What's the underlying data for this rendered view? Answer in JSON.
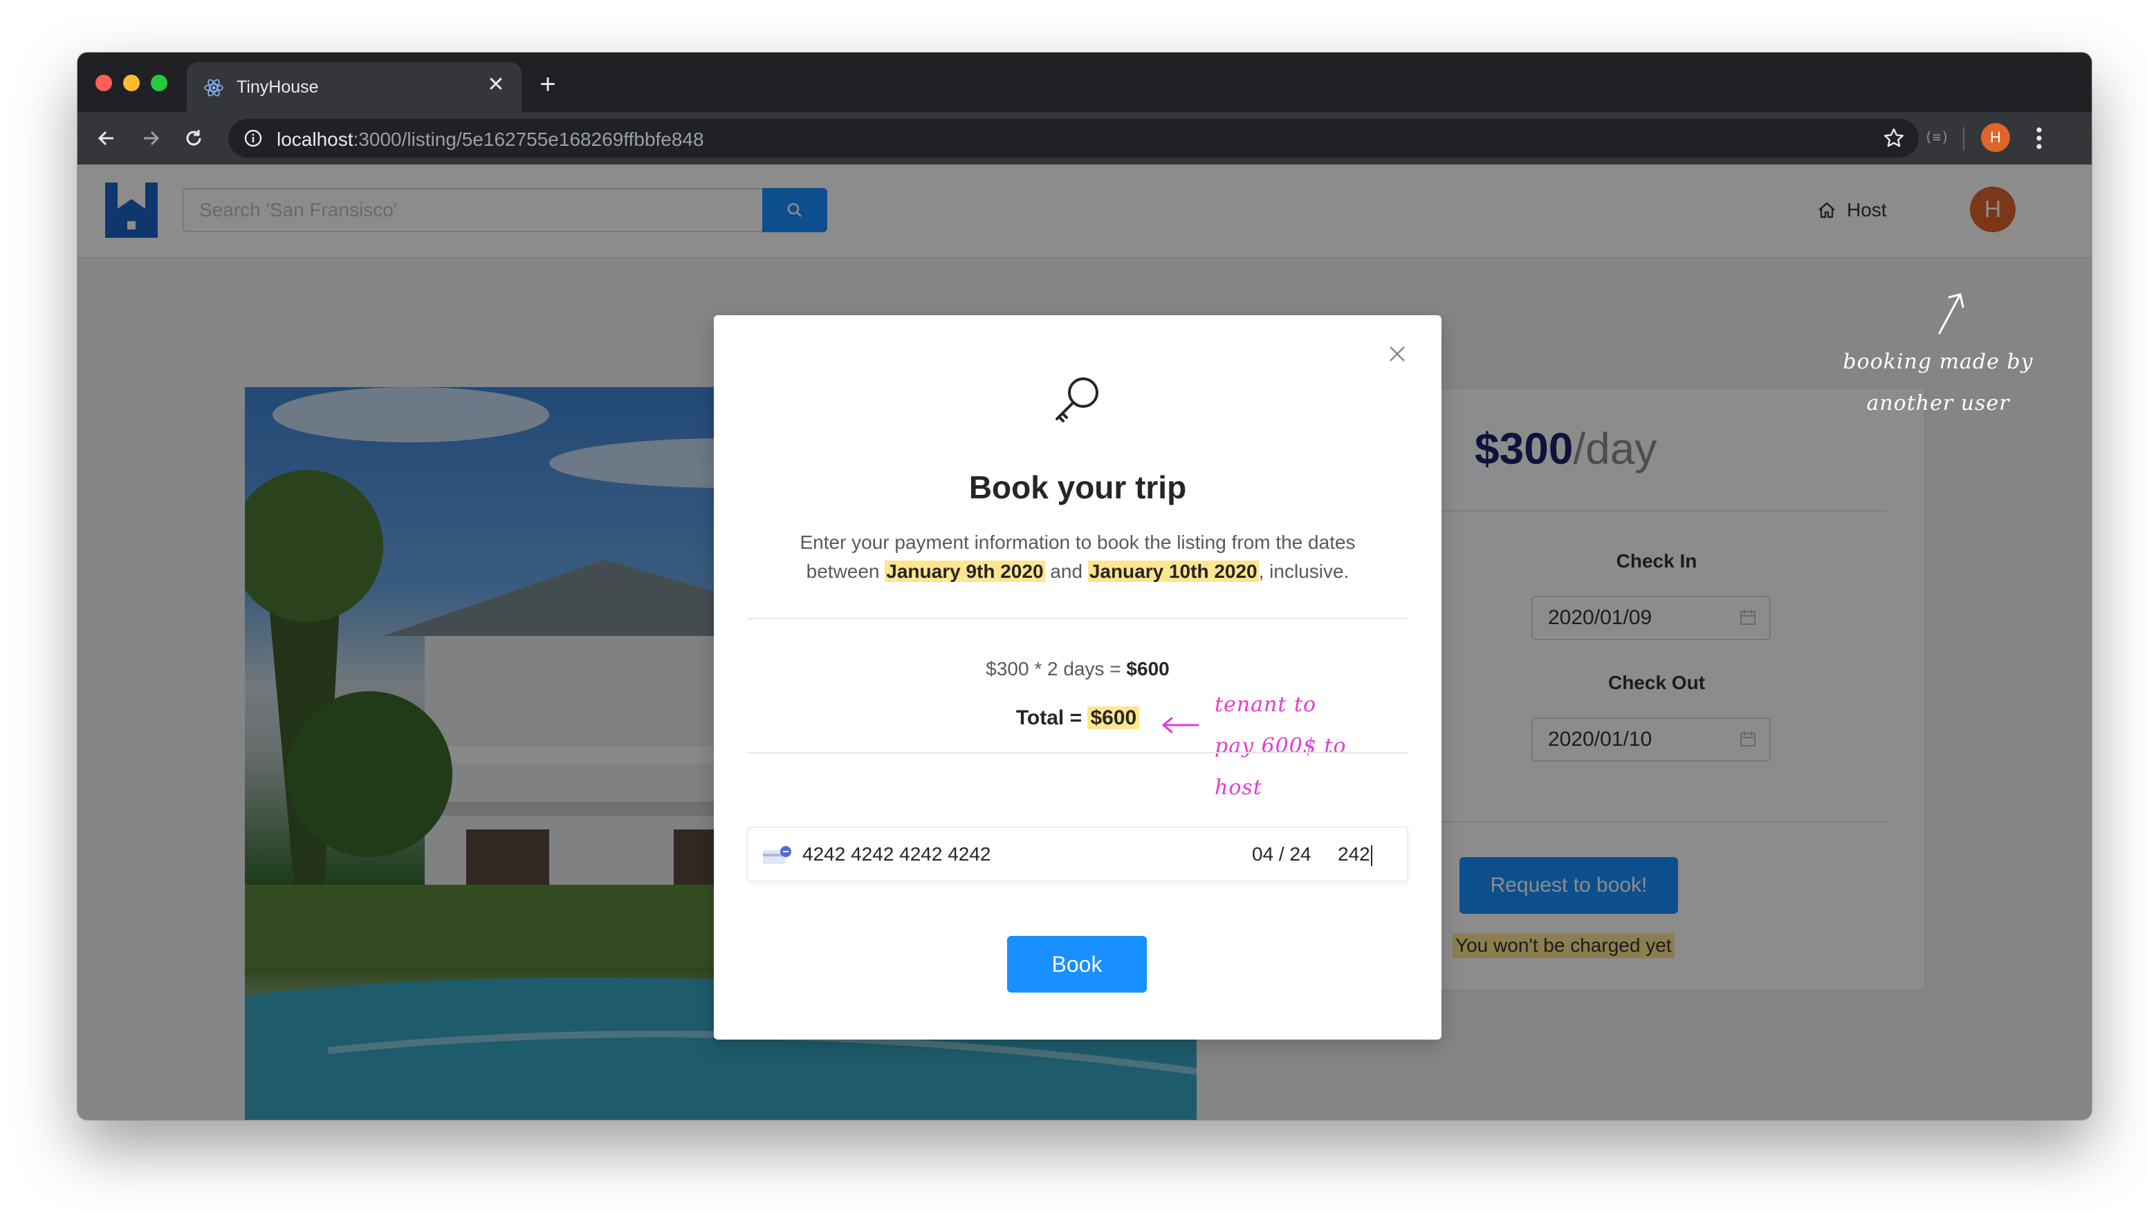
{
  "browser": {
    "tab_title": "TinyHouse",
    "new_tab": "+",
    "tab_close": "✕",
    "url_host": "localhost",
    "url_path": ":3000/listing/5e162755e168269ffbbfe848",
    "extension_label": "(≡)",
    "profile_initial": "H"
  },
  "header": {
    "search_placeholder": "Search 'San Fransisco'",
    "host_label": "Host",
    "avatar_initial": "H"
  },
  "listing": {
    "price": "$300",
    "price_unit": "/day",
    "check_in_label": "Check In",
    "check_in_value": "2020/01/09",
    "check_out_label": "Check Out",
    "check_out_value": "2020/01/10",
    "request_button": "Request to book!",
    "charge_note": "You won't be charged yet"
  },
  "modal": {
    "title": "Book your trip",
    "desc_part1": "Enter your payment information to book the listing from the dates between ",
    "date_start": "January 9th 2020",
    "desc_and": " and ",
    "date_end": "January 10th 2020",
    "desc_end": ", inclusive.",
    "calc_prefix": "$300 * 2 days = ",
    "calc_result": "$600",
    "total_label": "Total = ",
    "total_value": "$600",
    "card_number": "4242 4242 4242 4242",
    "card_expiry": "04 / 24",
    "card_cvc": "242",
    "book_button": "Book"
  },
  "annotations": {
    "booking_note": "booking made by another user",
    "tenant_note": "tenant to pay 600$ to host"
  },
  "colors": {
    "primary": "#1890ff",
    "highlight": "#ffe58f",
    "avatar": "#e0652a",
    "annotation_pink": "#e53ad8",
    "price_text": "#1d226c"
  }
}
